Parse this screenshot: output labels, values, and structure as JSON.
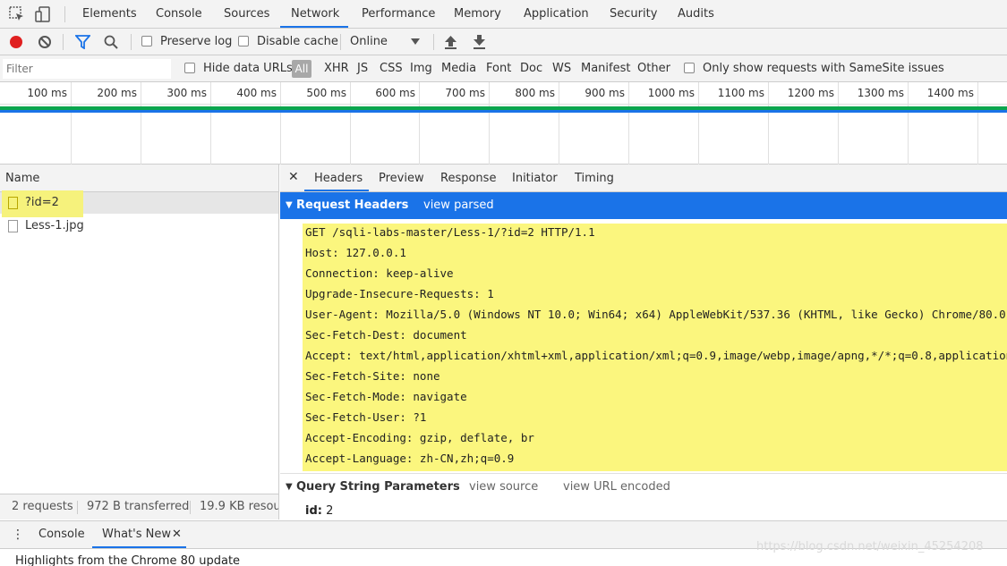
{
  "main_tabs": [
    "Elements",
    "Console",
    "Sources",
    "Network",
    "Performance",
    "Memory",
    "Application",
    "Security",
    "Audits"
  ],
  "active_main_tab": "Network",
  "toolbar": {
    "preserve_log": "Preserve log",
    "disable_cache": "Disable cache",
    "throttle": "Online"
  },
  "filter": {
    "placeholder": "Filter",
    "hide_data_urls": "Hide data URLs",
    "types": [
      "All",
      "XHR",
      "JS",
      "CSS",
      "Img",
      "Media",
      "Font",
      "Doc",
      "WS",
      "Manifest",
      "Other"
    ],
    "samesite": "Only show requests with SameSite issues"
  },
  "timeline": {
    "ticks": [
      "100 ms",
      "200 ms",
      "300 ms",
      "400 ms",
      "500 ms",
      "600 ms",
      "700 ms",
      "800 ms",
      "900 ms",
      "1000 ms",
      "1100 ms",
      "1200 ms",
      "1300 ms",
      "1400 ms"
    ]
  },
  "requests": {
    "header": "Name",
    "items": [
      "?id=2",
      "Less-1.jpg"
    ],
    "status": {
      "count": "2 requests",
      "transferred": "972 B transferred",
      "resources": "19.9 KB resources"
    }
  },
  "details": {
    "tabs": [
      "Headers",
      "Preview",
      "Response",
      "Initiator",
      "Timing"
    ],
    "active_tab": "Headers",
    "request_headers_title": "Request Headers",
    "view_parsed": "view parsed",
    "header_lines": [
      "GET /sqli-labs-master/Less-1/?id=2 HTTP/1.1",
      "Host: 127.0.0.1",
      "Connection: keep-alive",
      "Upgrade-Insecure-Requests: 1",
      "User-Agent: Mozilla/5.0 (Windows NT 10.0; Win64; x64) AppleWebKit/537.36 (KHTML, like Gecko) Chrome/80.0",
      "Sec-Fetch-Dest: document",
      "Accept: text/html,application/xhtml+xml,application/xml;q=0.9,image/webp,image/apng,*/*;q=0.8,application",
      "Sec-Fetch-Site: none",
      "Sec-Fetch-Mode: navigate",
      "Sec-Fetch-User: ?1",
      "Accept-Encoding: gzip, deflate, br",
      "Accept-Language: zh-CN,zh;q=0.9"
    ],
    "qsp_title": "Query String Parameters",
    "view_source": "view source",
    "view_url_encoded": "view URL encoded",
    "qsp": {
      "key": "id:",
      "value": "2"
    }
  },
  "drawer": {
    "tabs": [
      "Console",
      "What's New"
    ],
    "close": "✕",
    "body": "Highlights from the Chrome 80 update"
  },
  "watermark": "https://blog.csdn.net/weixin_45254208",
  "colors": {
    "accent": "#1a73e8",
    "highlight": "#fbf67e",
    "record": "#e02020"
  }
}
